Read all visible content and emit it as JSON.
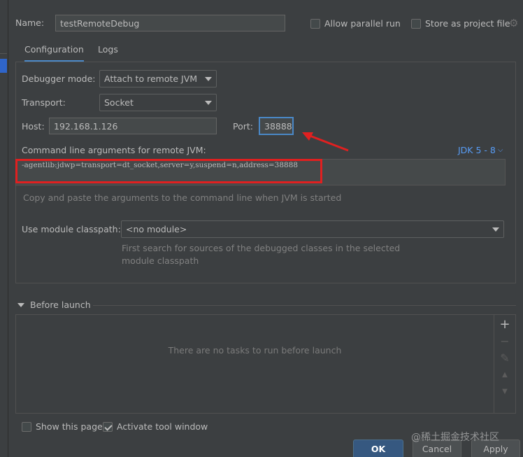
{
  "dialog": {
    "name_label": "Name:",
    "name_value": "testRemoteDebug",
    "allow_parallel_label": "Allow parallel run",
    "store_project_label": "Store as project file",
    "icons": {
      "gear": "gear-icon"
    }
  },
  "tabs": [
    {
      "label": "Configuration",
      "active": true
    },
    {
      "label": "Logs",
      "active": false
    }
  ],
  "config": {
    "debugger_mode_label": "Debugger mode:",
    "debugger_mode_value": "Attach to remote JVM",
    "transport_label": "Transport:",
    "transport_value": "Socket",
    "host_label": "Host:",
    "host_value": "192.168.1.126",
    "port_label": "Port:",
    "port_value": "38888",
    "cmdline_label": "Command line arguments for remote JVM:",
    "jdk_label": "JDK 5 - 8",
    "cmdline_value": "-agentlib:jdwp=transport=dt_socket,server=y,suspend=n,address=38888",
    "copy_hint": "Copy and paste the arguments to the command line when JVM is started",
    "module_label": "Use module classpath:",
    "module_value": "<no module>",
    "module_hint_line1": "First search for sources of the debugged classes in the selected",
    "module_hint_line2": "module classpath"
  },
  "before_launch": {
    "title": "Before launch",
    "empty_text": "There are no tasks to run before launch",
    "tools": [
      "plus-icon",
      "minus-icon",
      "edit-icon",
      "move-up-icon",
      "move-down-icon"
    ]
  },
  "footer": {
    "show_page_label": "Show this page",
    "show_page_checked": false,
    "activate_tool_label": "Activate tool window",
    "activate_tool_checked": true,
    "ok_label": "OK",
    "cancel_label": "Cancel",
    "apply_label": "Apply",
    "watermark": "@稀土掘金技术社区"
  },
  "colors": {
    "background": "#3c3f41",
    "accent": "#4a88c7",
    "annotation": "#e02020",
    "primary_button": "#365880"
  }
}
